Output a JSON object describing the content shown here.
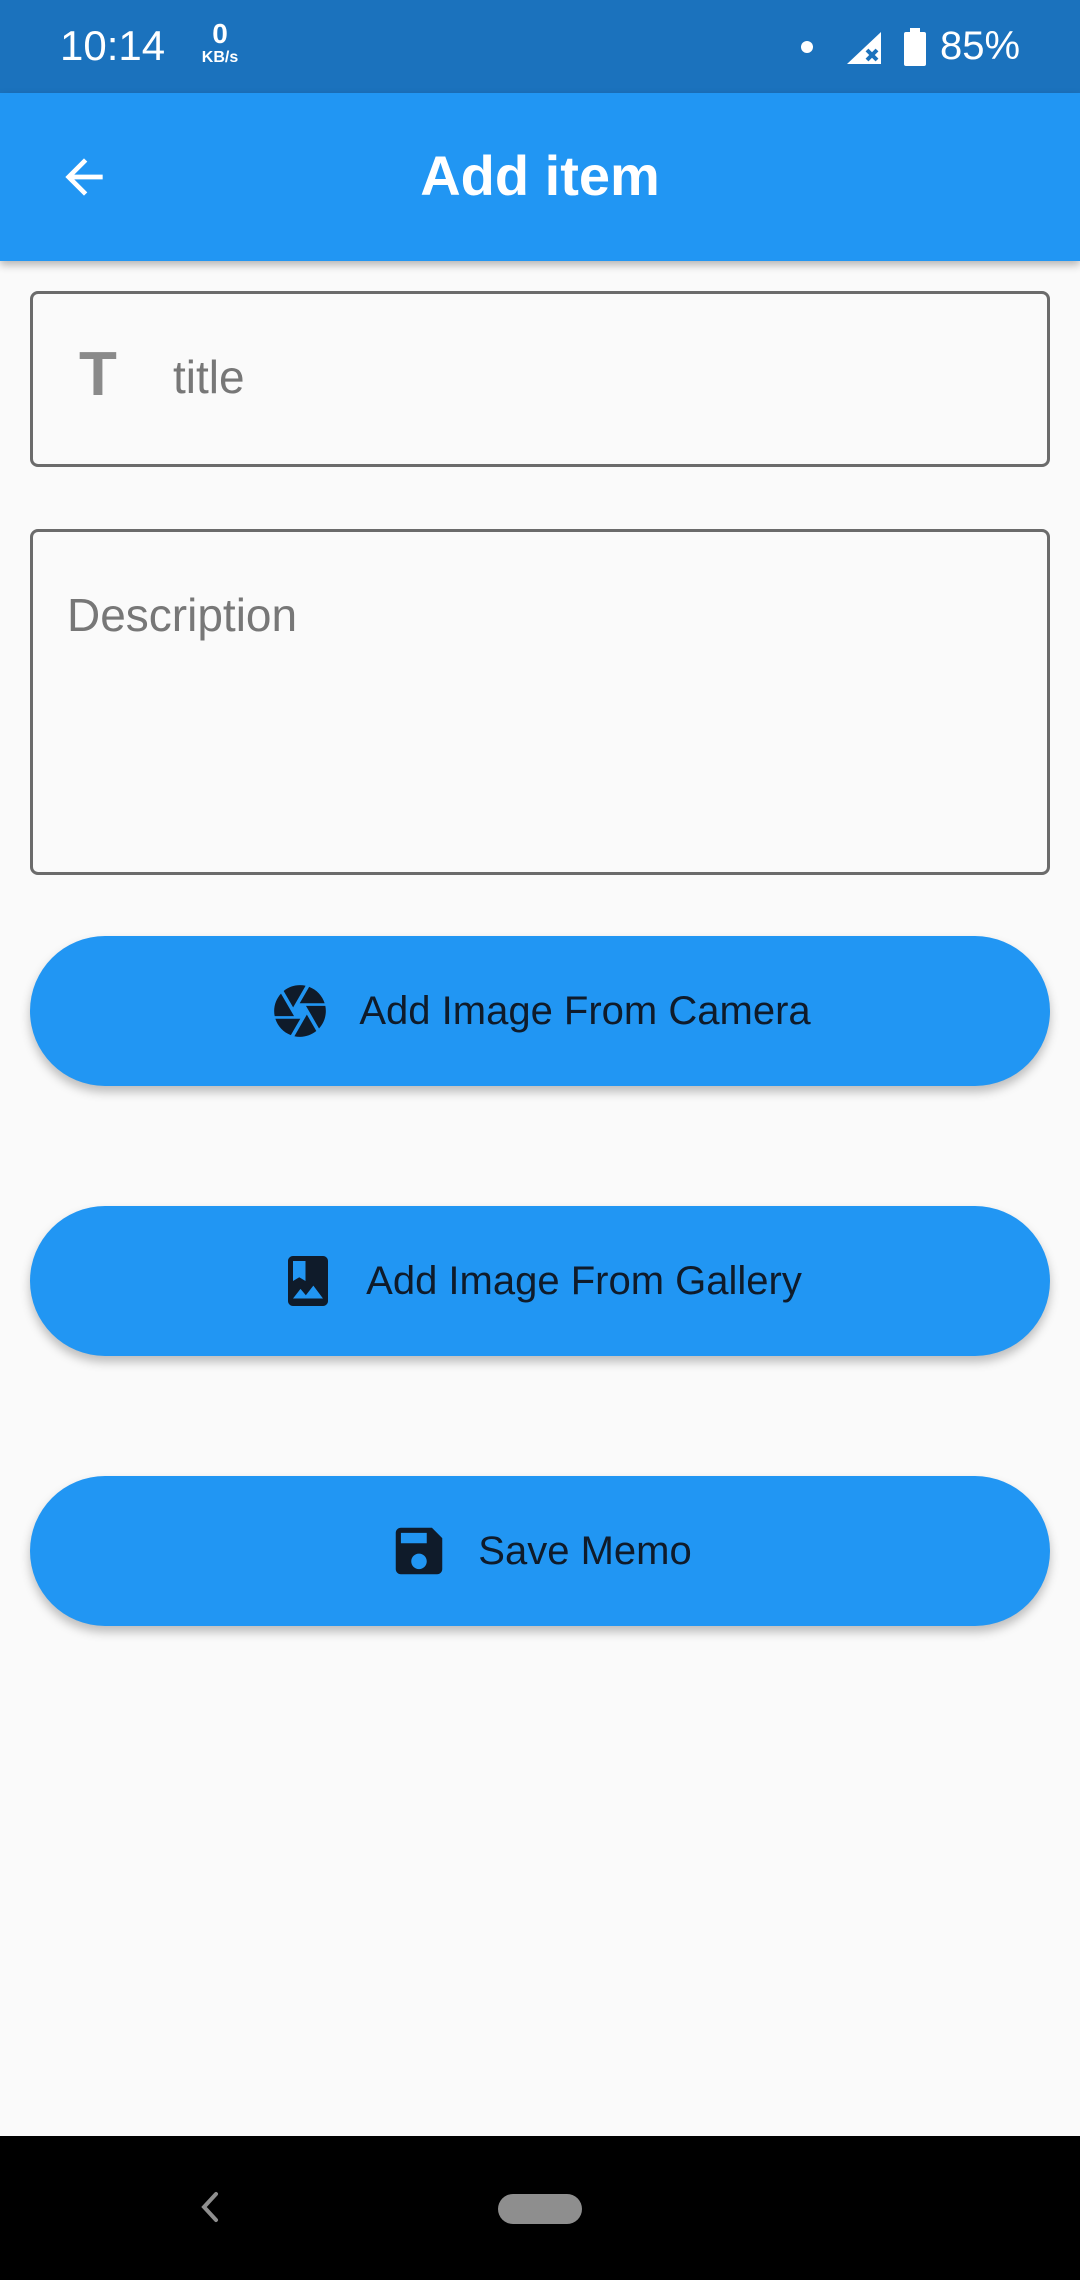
{
  "status_bar": {
    "time": "10:14",
    "net_speed": "0",
    "net_speed_unit": "KB/s",
    "battery": "85%"
  },
  "app_bar": {
    "title": "Add item",
    "back_icon": "arrow-left-icon"
  },
  "form": {
    "title_icon": "T",
    "title_placeholder": "title",
    "description_placeholder": "Description"
  },
  "buttons": {
    "camera": {
      "label": "Add Image From Camera",
      "icon": "camera-shutter-icon"
    },
    "gallery": {
      "label": "Add Image From Gallery",
      "icon": "photo-album-icon"
    },
    "save": {
      "label": "Save Memo",
      "icon": "save-icon"
    }
  },
  "colors": {
    "primary": "#2196f3",
    "status_bar": "#1b72bd",
    "background": "#fafafa",
    "button_text": "#0f1b2a"
  }
}
